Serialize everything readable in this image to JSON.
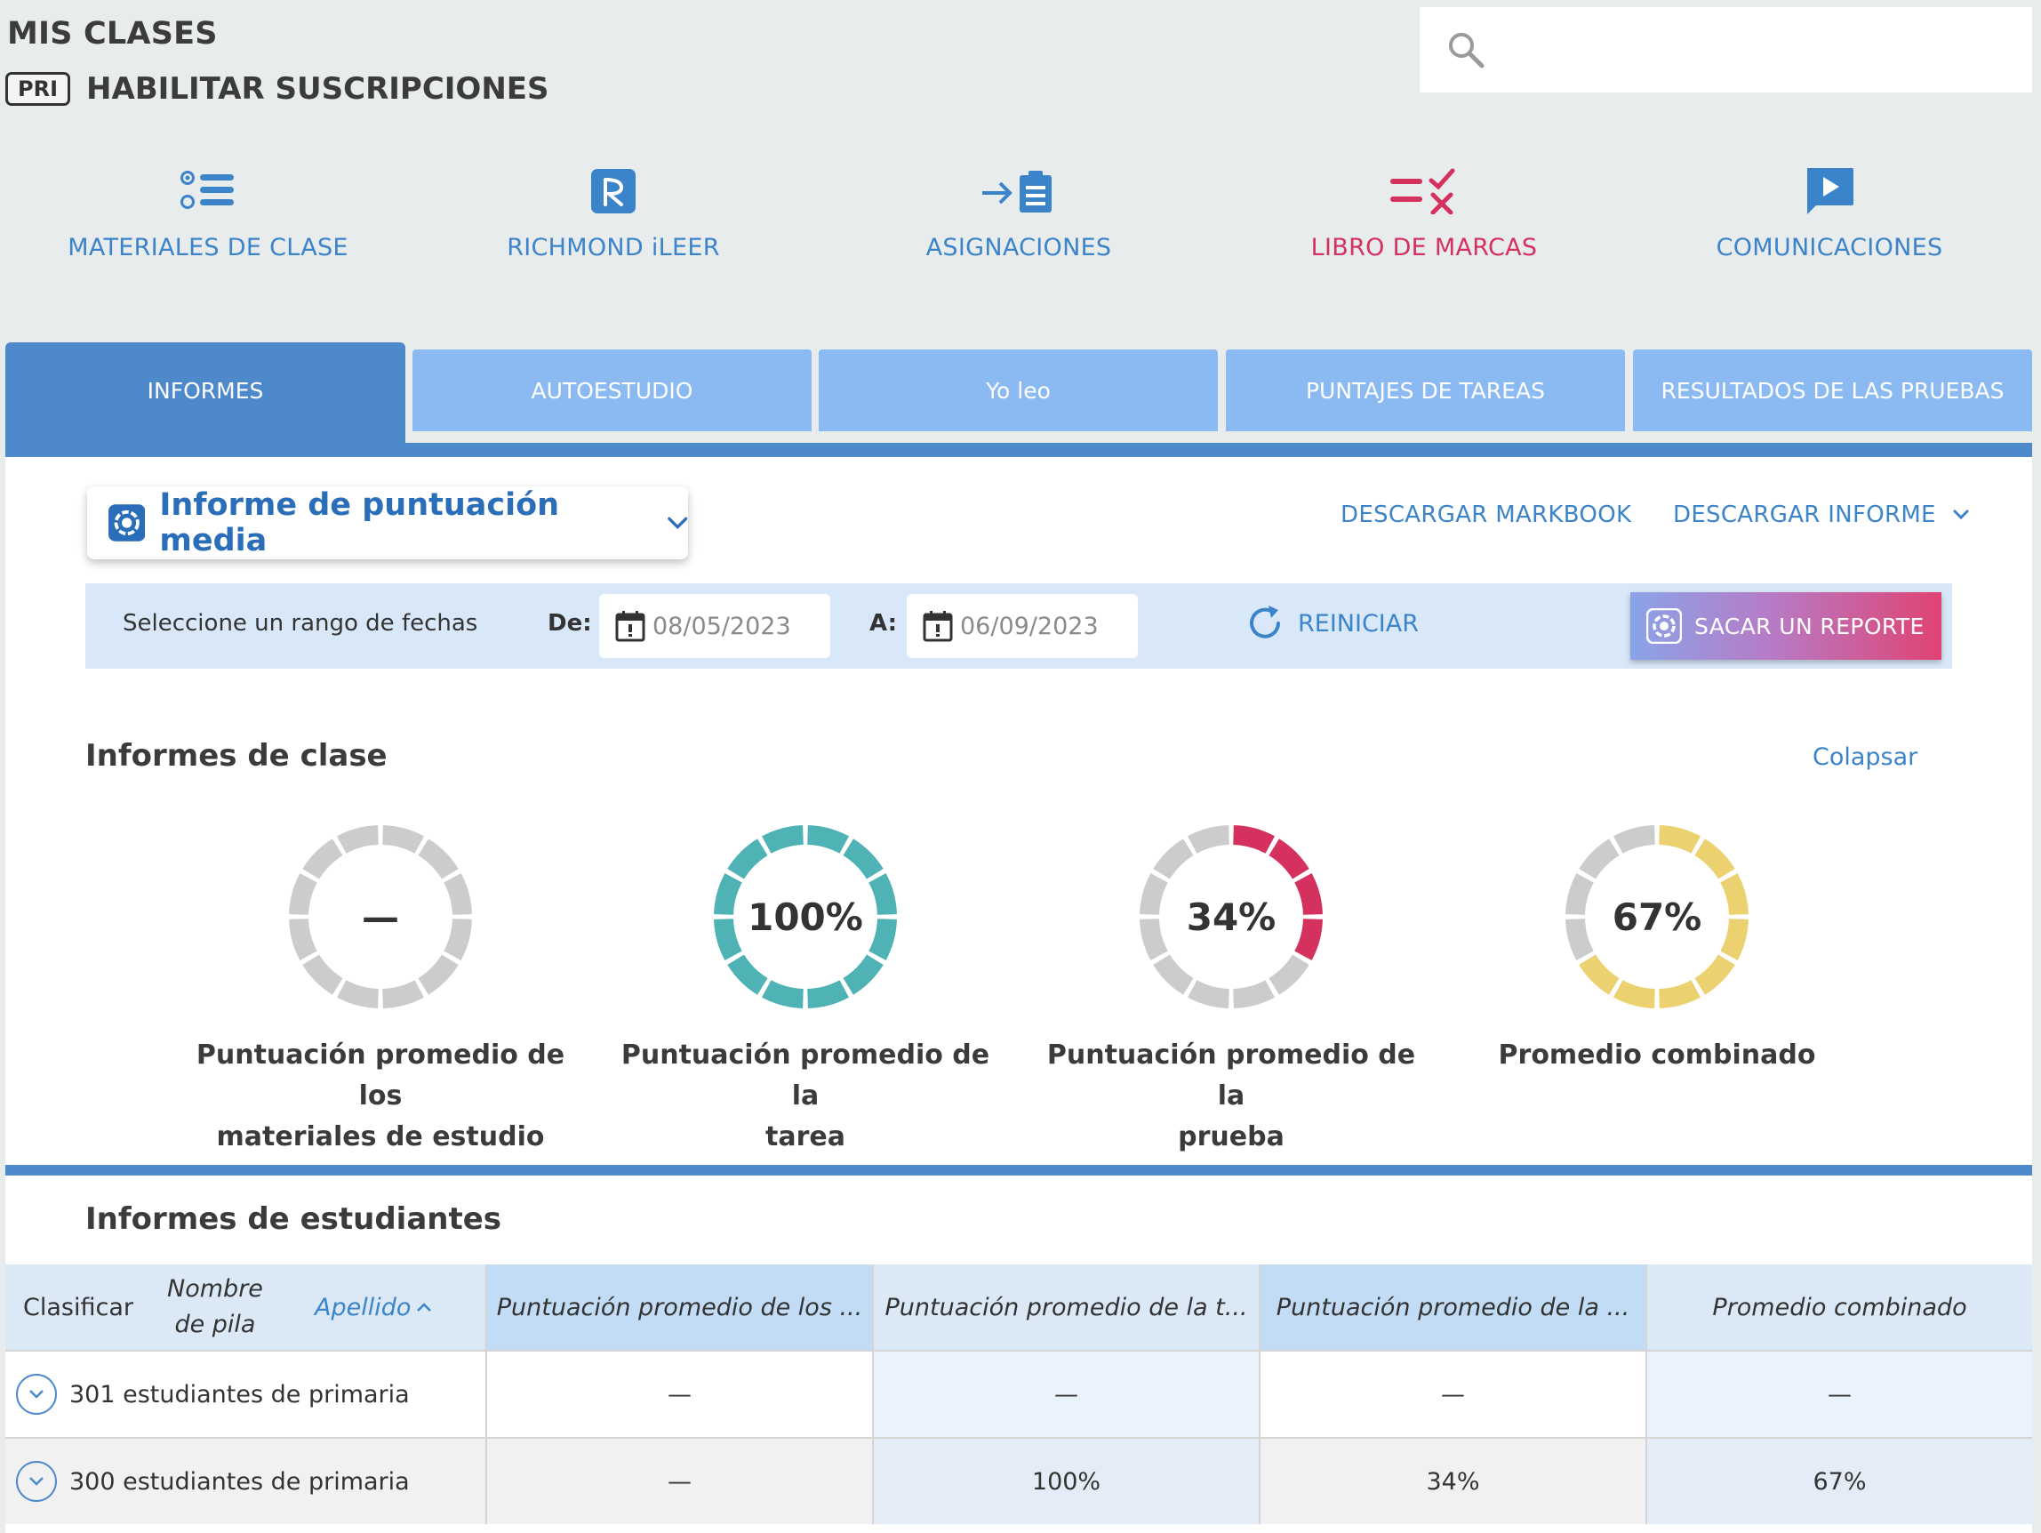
{
  "header": {
    "title": "MIS CLASES",
    "badge": "PRI",
    "subtitle": "HABILITAR SUSCRIPCIONES"
  },
  "search": {
    "placeholder": ""
  },
  "nav": [
    {
      "label": "MATERIALES DE CLASE",
      "icon": "list-icon"
    },
    {
      "label": "RICHMOND iLEER",
      "icon": "richmond-logo-icon"
    },
    {
      "label": "ASIGNACIONES",
      "icon": "clipboard-arrow-icon"
    },
    {
      "label": "LIBRO DE MARCAS",
      "icon": "checklist-icon",
      "active": true
    },
    {
      "label": "COMUNICACIONES",
      "icon": "play-message-icon"
    }
  ],
  "tabs": [
    "INFORMES",
    "AUTOESTUDIO",
    "Yo leo",
    "PUNTAJES DE TAREAS",
    "RESULTADOS DE LAS PRUEBAS"
  ],
  "report": {
    "selected": "Informe de puntuación media",
    "download_markbook": "DESCARGAR MARKBOOK",
    "download_report": "DESCARGAR INFORME"
  },
  "dates": {
    "range_label": "Seleccione un rango de fechas",
    "from_label": "De:",
    "from_value": "08/05/2023",
    "to_label": "A:",
    "to_value": "06/09/2023",
    "reset": "REINICIAR",
    "run": "SACAR UN REPORTE"
  },
  "class_reports": {
    "title": "Informes de clase",
    "collapse": "Colapsar",
    "gauges": [
      {
        "value_text": "—",
        "fraction": 0,
        "color": "#cccccc",
        "label": [
          "Puntuación promedio de los",
          "materiales de estudio"
        ]
      },
      {
        "value_text": "100%",
        "fraction": 1.0,
        "color": "#4fb3b5",
        "label": [
          "Puntuación promedio de la",
          "tarea"
        ]
      },
      {
        "value_text": "34%",
        "fraction": 0.34,
        "color": "#d4315e",
        "label": [
          "Puntuación promedio de la",
          "prueba"
        ]
      },
      {
        "value_text": "67%",
        "fraction": 0.67,
        "color": "#ecd170",
        "label": [
          "Promedio combinado",
          ""
        ]
      }
    ]
  },
  "student_reports": {
    "title": "Informes de estudiantes",
    "sort_label": "Clasificar",
    "first_name": "Nombre de pila",
    "last_name": "Apellido",
    "columns": [
      "Puntuación promedio de los ...",
      "Puntuación promedio de la t...",
      "Puntuación promedio de la ...",
      "Promedio combinado"
    ],
    "rows": [
      {
        "name": "301 estudiantes de primaria",
        "values": [
          "—",
          "—",
          "—",
          "—"
        ]
      },
      {
        "name": "300 estudiantes de primaria",
        "values": [
          "—",
          "100%",
          "34%",
          "67%"
        ]
      }
    ]
  },
  "colors": {
    "accent": "#3c84c9",
    "active_nav": "#d4315e",
    "tab": "#8bbaf2",
    "tab_active": "#4e89cb"
  }
}
